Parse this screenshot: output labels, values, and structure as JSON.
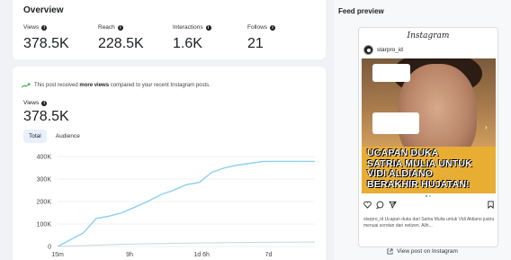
{
  "overview": {
    "title": "Overview",
    "metrics": [
      {
        "label": "Views",
        "value": "378.5K"
      },
      {
        "label": "Reach",
        "value": "228.5K"
      },
      {
        "label": "Interactions",
        "value": "1.6K"
      },
      {
        "label": "Follows",
        "value": "21"
      }
    ]
  },
  "performance": {
    "notice_prefix": "This post received",
    "notice_bold": "more views",
    "notice_suffix": "compared to your recent Instagram posts.",
    "views_label": "Views",
    "views_value": "378.5K",
    "tabs": [
      {
        "label": "Total",
        "active": true
      },
      {
        "label": "Audience",
        "active": false
      }
    ]
  },
  "chart_data": {
    "type": "line",
    "x_ticks": [
      "15m",
      "9h",
      "1d 6h",
      "7d"
    ],
    "y_ticks": [
      "0",
      "100K",
      "200K",
      "300K",
      "400K"
    ],
    "ylim": [
      0,
      400000
    ],
    "series": [
      {
        "color": "#8ccff0",
        "x": [
          0,
          0.05,
          0.1,
          0.15,
          0.2,
          0.25,
          0.3,
          0.35,
          0.4,
          0.45,
          0.5,
          0.55,
          0.6,
          0.65,
          0.7,
          0.75,
          0.8,
          0.85,
          0.9,
          1.0
        ],
        "values": [
          0,
          30000,
          60000,
          125000,
          135000,
          150000,
          175000,
          200000,
          230000,
          250000,
          275000,
          285000,
          330000,
          350000,
          362000,
          370000,
          378500,
          378500,
          378500,
          378500
        ]
      },
      {
        "color": "#c9d3dd",
        "x": [
          0,
          0.25,
          0.5,
          0.75,
          1.0
        ],
        "values": [
          0,
          10000,
          15000,
          18000,
          20000
        ]
      }
    ]
  },
  "feed_preview": {
    "title": "Feed preview",
    "platform_logo": "Instagram",
    "username": "starpro_id",
    "headline_lines": [
      "UCAPAN DUKA",
      "SATRIA MULIA UNTUK",
      "VIDI ALDIANO",
      "BERAKHIR HUJATAN!"
    ],
    "caption": "starpro_id Ucapan duka dari Satria Mulia untuk Vidi Aldiano justru menuai sorotan dari netizen. Alih...",
    "view_post_label": "View post on Instagram"
  }
}
